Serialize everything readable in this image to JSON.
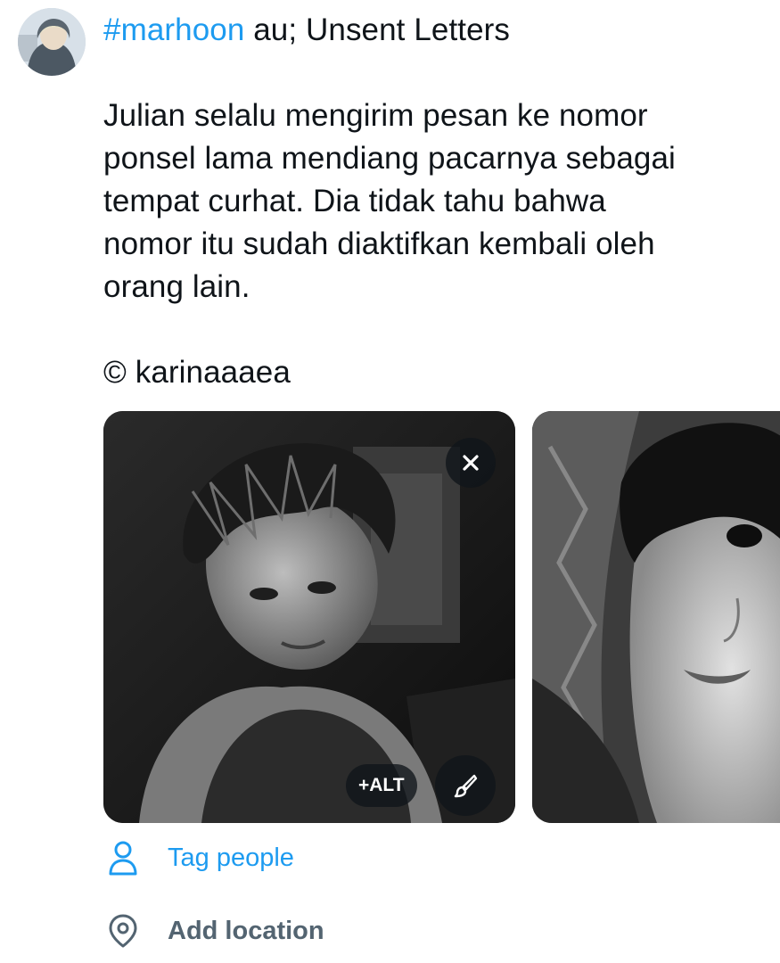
{
  "compose": {
    "hashtag": "#marhoon",
    "title_rest": " au; Unsent Letters",
    "body_lines": [
      "Julian selalu mengirim pesan ke nomor",
      "ponsel lama mendiang pacarnya sebagai",
      "tempat curhat. Dia tidak tahu bahwa",
      "nomor itu sudah diaktifkan kembali oleh",
      "orang lain."
    ],
    "credit": "© karinaaaea"
  },
  "media": {
    "alt_label": "+ALT",
    "remove_icon": "close-icon",
    "edit_icon": "paintbrush-icon"
  },
  "options": {
    "tag_people": "Tag people",
    "add_location": "Add location"
  },
  "colors": {
    "accent": "#1d9bf0",
    "muted": "#536471",
    "text": "#0f1419"
  }
}
